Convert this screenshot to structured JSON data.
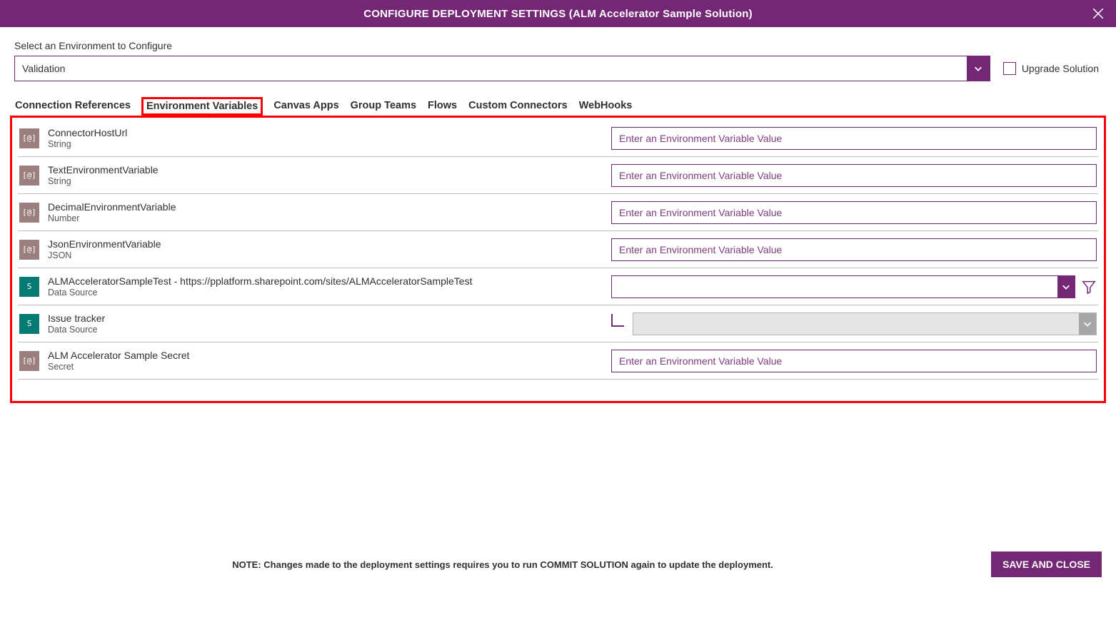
{
  "header": {
    "title": "CONFIGURE DEPLOYMENT SETTINGS (ALM Accelerator Sample Solution)"
  },
  "environment": {
    "label": "Select an Environment to Configure",
    "value": "Validation",
    "upgrade_label": "Upgrade Solution"
  },
  "tabs": [
    {
      "label": "Connection References",
      "active": false
    },
    {
      "label": "Environment Variables",
      "active": true
    },
    {
      "label": "Canvas Apps",
      "active": false
    },
    {
      "label": "Group Teams",
      "active": false
    },
    {
      "label": "Flows",
      "active": false
    },
    {
      "label": "Custom Connectors",
      "active": false
    },
    {
      "label": "WebHooks",
      "active": false
    }
  ],
  "variables": [
    {
      "name": "ConnectorHostUrl",
      "type": "String",
      "kind": "text",
      "icon": "brown",
      "placeholder": "Enter an Environment Variable Value"
    },
    {
      "name": "TextEnvironmentVariable",
      "type": "String",
      "kind": "text",
      "icon": "brown",
      "placeholder": "Enter an Environment Variable Value"
    },
    {
      "name": "DecimalEnvironmentVariable",
      "type": "Number",
      "kind": "text",
      "icon": "brown",
      "placeholder": "Enter an Environment Variable Value"
    },
    {
      "name": "JsonEnvironmentVariable",
      "type": "JSON",
      "kind": "text",
      "icon": "brown",
      "placeholder": "Enter an Environment Variable Value"
    },
    {
      "name": "ALMAcceleratorSampleTest - https://pplatform.sharepoint.com/sites/ALMAcceleratorSampleTest",
      "type": "Data Source",
      "kind": "datasource",
      "icon": "teal"
    },
    {
      "name": "Issue tracker",
      "type": "Data Source",
      "kind": "datasource-child",
      "icon": "teal"
    },
    {
      "name": "ALM Accelerator Sample Secret",
      "type": "Secret",
      "kind": "text",
      "icon": "brown",
      "placeholder": "Enter an Environment Variable Value"
    }
  ],
  "footer": {
    "note": "NOTE: Changes made to the deployment settings requires you to run COMMIT SOLUTION again to update the deployment.",
    "save_label": "SAVE AND CLOSE"
  },
  "icons": {
    "var_glyph": "[@]",
    "sp_glyph": "S"
  }
}
